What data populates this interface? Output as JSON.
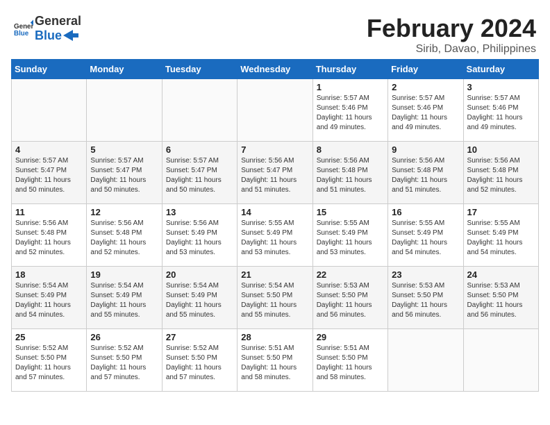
{
  "header": {
    "logo_line1": "General",
    "logo_line2": "Blue",
    "month": "February 2024",
    "location": "Sirib, Davao, Philippines"
  },
  "weekdays": [
    "Sunday",
    "Monday",
    "Tuesday",
    "Wednesday",
    "Thursday",
    "Friday",
    "Saturday"
  ],
  "weeks": [
    [
      {
        "day": "",
        "empty": true
      },
      {
        "day": "",
        "empty": true
      },
      {
        "day": "",
        "empty": true
      },
      {
        "day": "",
        "empty": true
      },
      {
        "day": "1",
        "sunrise": "5:57 AM",
        "sunset": "5:46 PM",
        "daylight": "11 hours and 49 minutes."
      },
      {
        "day": "2",
        "sunrise": "5:57 AM",
        "sunset": "5:46 PM",
        "daylight": "11 hours and 49 minutes."
      },
      {
        "day": "3",
        "sunrise": "5:57 AM",
        "sunset": "5:46 PM",
        "daylight": "11 hours and 49 minutes."
      }
    ],
    [
      {
        "day": "4",
        "sunrise": "5:57 AM",
        "sunset": "5:47 PM",
        "daylight": "11 hours and 50 minutes."
      },
      {
        "day": "5",
        "sunrise": "5:57 AM",
        "sunset": "5:47 PM",
        "daylight": "11 hours and 50 minutes."
      },
      {
        "day": "6",
        "sunrise": "5:57 AM",
        "sunset": "5:47 PM",
        "daylight": "11 hours and 50 minutes."
      },
      {
        "day": "7",
        "sunrise": "5:56 AM",
        "sunset": "5:47 PM",
        "daylight": "11 hours and 51 minutes."
      },
      {
        "day": "8",
        "sunrise": "5:56 AM",
        "sunset": "5:48 PM",
        "daylight": "11 hours and 51 minutes."
      },
      {
        "day": "9",
        "sunrise": "5:56 AM",
        "sunset": "5:48 PM",
        "daylight": "11 hours and 51 minutes."
      },
      {
        "day": "10",
        "sunrise": "5:56 AM",
        "sunset": "5:48 PM",
        "daylight": "11 hours and 52 minutes."
      }
    ],
    [
      {
        "day": "11",
        "sunrise": "5:56 AM",
        "sunset": "5:48 PM",
        "daylight": "11 hours and 52 minutes."
      },
      {
        "day": "12",
        "sunrise": "5:56 AM",
        "sunset": "5:48 PM",
        "daylight": "11 hours and 52 minutes."
      },
      {
        "day": "13",
        "sunrise": "5:56 AM",
        "sunset": "5:49 PM",
        "daylight": "11 hours and 53 minutes."
      },
      {
        "day": "14",
        "sunrise": "5:55 AM",
        "sunset": "5:49 PM",
        "daylight": "11 hours and 53 minutes."
      },
      {
        "day": "15",
        "sunrise": "5:55 AM",
        "sunset": "5:49 PM",
        "daylight": "11 hours and 53 minutes."
      },
      {
        "day": "16",
        "sunrise": "5:55 AM",
        "sunset": "5:49 PM",
        "daylight": "11 hours and 54 minutes."
      },
      {
        "day": "17",
        "sunrise": "5:55 AM",
        "sunset": "5:49 PM",
        "daylight": "11 hours and 54 minutes."
      }
    ],
    [
      {
        "day": "18",
        "sunrise": "5:54 AM",
        "sunset": "5:49 PM",
        "daylight": "11 hours and 54 minutes."
      },
      {
        "day": "19",
        "sunrise": "5:54 AM",
        "sunset": "5:49 PM",
        "daylight": "11 hours and 55 minutes."
      },
      {
        "day": "20",
        "sunrise": "5:54 AM",
        "sunset": "5:49 PM",
        "daylight": "11 hours and 55 minutes."
      },
      {
        "day": "21",
        "sunrise": "5:54 AM",
        "sunset": "5:50 PM",
        "daylight": "11 hours and 55 minutes."
      },
      {
        "day": "22",
        "sunrise": "5:53 AM",
        "sunset": "5:50 PM",
        "daylight": "11 hours and 56 minutes."
      },
      {
        "day": "23",
        "sunrise": "5:53 AM",
        "sunset": "5:50 PM",
        "daylight": "11 hours and 56 minutes."
      },
      {
        "day": "24",
        "sunrise": "5:53 AM",
        "sunset": "5:50 PM",
        "daylight": "11 hours and 56 minutes."
      }
    ],
    [
      {
        "day": "25",
        "sunrise": "5:52 AM",
        "sunset": "5:50 PM",
        "daylight": "11 hours and 57 minutes."
      },
      {
        "day": "26",
        "sunrise": "5:52 AM",
        "sunset": "5:50 PM",
        "daylight": "11 hours and 57 minutes."
      },
      {
        "day": "27",
        "sunrise": "5:52 AM",
        "sunset": "5:50 PM",
        "daylight": "11 hours and 57 minutes."
      },
      {
        "day": "28",
        "sunrise": "5:51 AM",
        "sunset": "5:50 PM",
        "daylight": "11 hours and 58 minutes."
      },
      {
        "day": "29",
        "sunrise": "5:51 AM",
        "sunset": "5:50 PM",
        "daylight": "11 hours and 58 minutes."
      },
      {
        "day": "",
        "empty": true
      },
      {
        "day": "",
        "empty": true
      }
    ]
  ],
  "labels": {
    "sunrise": "Sunrise:",
    "sunset": "Sunset:",
    "daylight": "Daylight:"
  }
}
